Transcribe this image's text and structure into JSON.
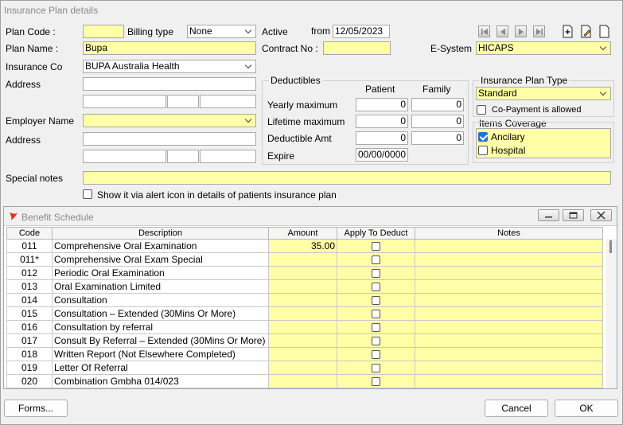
{
  "window": {
    "title": "Insurance Plan details"
  },
  "plan": {
    "code_label": "Plan Code :",
    "code_value": "",
    "billing_type_label": "Billing type",
    "billing_type_value": "None",
    "active_label": "Active",
    "from_label": "from",
    "from_value": "12/05/2023",
    "name_label": "Plan Name :",
    "name_value": "Bupa",
    "contract_label": "Contract No :",
    "contract_value": "",
    "esystem_label": "E-System",
    "esystem_value": "HICAPS",
    "insco_label": "Insurance Co",
    "insco_value": "BUPA Australia Health",
    "address_label": "Address",
    "employer_label": "Employer Name",
    "employer_value": "",
    "address2_label": "Address",
    "special_notes_label": "Special notes",
    "special_notes_value": "",
    "alert_icon_label": "Show it via alert icon in details of patients insurance plan"
  },
  "deductibles": {
    "title": "Deductibles",
    "col_patient": "Patient",
    "col_family": "Family",
    "rows": [
      {
        "label": "Yearly maximum",
        "patient": "0",
        "family": "0"
      },
      {
        "label": "Lifetime maximum",
        "patient": "0",
        "family": "0"
      },
      {
        "label": "Deductible Amt",
        "patient": "0",
        "family": "0"
      }
    ],
    "expire_label": "Expire",
    "expire_value": "00/00/0000"
  },
  "plan_type": {
    "title": "Insurance Plan Type",
    "value": "Standard",
    "copay_label": "Co-Payment is allowed"
  },
  "coverage": {
    "title": "Items Coverage",
    "items": [
      {
        "label": "Ancilary",
        "checked": true
      },
      {
        "label": "Hospital",
        "checked": false
      }
    ]
  },
  "benefit_schedule": {
    "title": "Benefit Schedule",
    "columns": [
      "Code",
      "Description",
      "Amount",
      "Apply To Deduct",
      "Notes"
    ],
    "rows": [
      {
        "code": "011",
        "desc": "Comprehensive Oral Examination",
        "amount": "35.00"
      },
      {
        "code": "011*",
        "desc": "Comprehensive Oral Exam Special",
        "amount": ""
      },
      {
        "code": "012",
        "desc": "Periodic Oral Examination",
        "amount": ""
      },
      {
        "code": "013",
        "desc": "Oral Examination Limited",
        "amount": ""
      },
      {
        "code": "014",
        "desc": "Consultation",
        "amount": ""
      },
      {
        "code": "015",
        "desc": "Consultation – Extended (30Mins Or More)",
        "amount": ""
      },
      {
        "code": "016",
        "desc": "Consultation by referral",
        "amount": ""
      },
      {
        "code": "017",
        "desc": "Consult By Referral – Extended  (30Mins Or More)",
        "amount": ""
      },
      {
        "code": "018",
        "desc": "Written Report (Not Elsewhere Completed)",
        "amount": ""
      },
      {
        "code": "019",
        "desc": "Letter Of Referral",
        "amount": ""
      },
      {
        "code": "020",
        "desc": "Combination Gmbha 014/023",
        "amount": ""
      }
    ]
  },
  "footer": {
    "forms_label": "Forms...",
    "cancel_label": "Cancel",
    "ok_label": "OK"
  }
}
